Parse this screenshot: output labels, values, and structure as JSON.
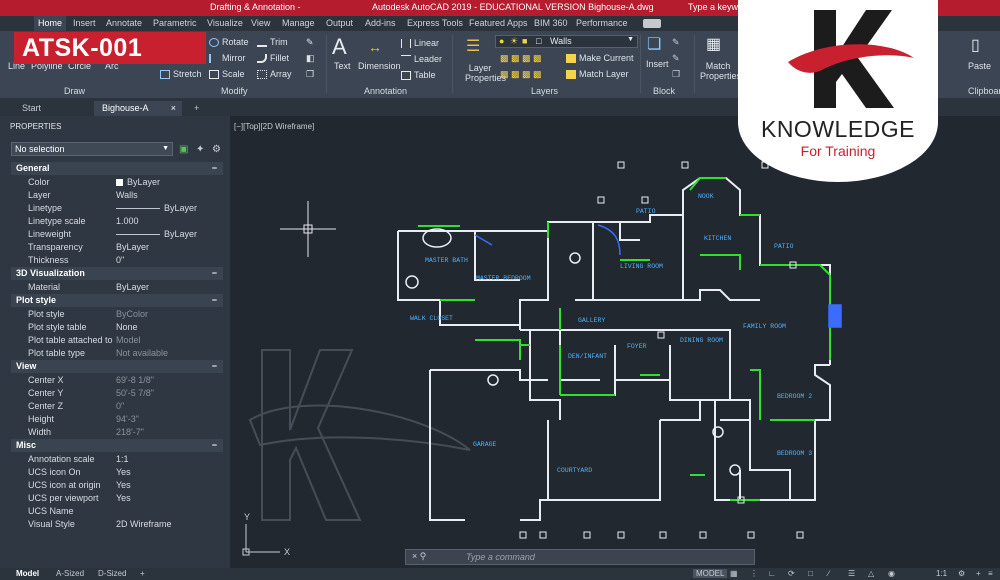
{
  "titlebar": {
    "left": "Drafting & Annotation -",
    "center": "Autodesk AutoCAD 2019 - EDUCATIONAL VERSION   Bighouse-A.dwg",
    "search": "Type a keyword"
  },
  "tabs": [
    "Home",
    "Insert",
    "Annotate",
    "Parametric",
    "Visualize",
    "View",
    "Manage",
    "Output",
    "Add-ins",
    "Express Tools",
    "Featured Apps",
    "BIM 360",
    "Performance"
  ],
  "ribbon": {
    "draw_tools": [
      "Line",
      "Polyline",
      "Circle",
      "Arc"
    ],
    "modify_tools": [
      "Rotate",
      "Mirror",
      "Stretch",
      "Trim",
      "Fillet",
      "Scale",
      "Array"
    ],
    "annotation_tools": [
      "Text",
      "Dimension",
      "Linear",
      "Leader",
      "Table"
    ],
    "layer_properties": "Layer Properties",
    "layer_current": "Walls",
    "layer_tools": [
      "Make Current",
      "Match Layer"
    ],
    "insert": "Insert",
    "match_properties": "Match Properties",
    "paste": "Paste",
    "panels": [
      "Draw",
      "Modify",
      "Annotation",
      "Layers",
      "Block",
      "Clipboard"
    ]
  },
  "banner": "ATSK-001",
  "logo": {
    "title": "KNOWLEDGE",
    "subtitle": "For Training"
  },
  "doctabs": [
    "Start",
    "Bighouse-A"
  ],
  "properties": {
    "title": "PROPERTIES",
    "selection": "No selection",
    "sections": [
      {
        "name": "General",
        "rows": [
          {
            "k": "Color",
            "v": "ByLayer"
          },
          {
            "k": "Layer",
            "v": "Walls"
          },
          {
            "k": "Linetype",
            "v": "ByLayer"
          },
          {
            "k": "Linetype scale",
            "v": "1.000"
          },
          {
            "k": "Lineweight",
            "v": "ByLayer"
          },
          {
            "k": "Transparency",
            "v": "ByLayer"
          },
          {
            "k": "Thickness",
            "v": "0\""
          }
        ]
      },
      {
        "name": "3D Visualization",
        "rows": [
          {
            "k": "Material",
            "v": "ByLayer"
          }
        ]
      },
      {
        "name": "Plot style",
        "rows": [
          {
            "k": "Plot style",
            "v": "ByColor"
          },
          {
            "k": "Plot style table",
            "v": "None"
          },
          {
            "k": "Plot table attached to",
            "v": "Model"
          },
          {
            "k": "Plot table type",
            "v": "Not available"
          }
        ]
      },
      {
        "name": "View",
        "rows": [
          {
            "k": "Center X",
            "v": "69'-8 1/8\""
          },
          {
            "k": "Center Y",
            "v": "50'-5 7/8\""
          },
          {
            "k": "Center Z",
            "v": "0\""
          },
          {
            "k": "Height",
            "v": "94'-3\""
          },
          {
            "k": "Width",
            "v": "218'-7\""
          }
        ]
      },
      {
        "name": "Misc",
        "rows": [
          {
            "k": "Annotation scale",
            "v": "1:1"
          },
          {
            "k": "UCS icon On",
            "v": "Yes"
          },
          {
            "k": "UCS icon at origin",
            "v": "Yes"
          },
          {
            "k": "UCS per viewport",
            "v": "Yes"
          },
          {
            "k": "UCS Name",
            "v": ""
          },
          {
            "k": "Visual Style",
            "v": "2D Wireframe"
          }
        ]
      }
    ]
  },
  "viewport_label": "[−][Top][2D Wireframe]",
  "plan_labels": {
    "patio_top": "PATIO",
    "patio_right": "PATIO",
    "nook": "NOOK",
    "kitchen": "KITCHEN",
    "living_room": "LIVING ROOM",
    "master_bath": "MASTER BATH",
    "master_bedroom": "MASTER BEDROOM",
    "gallery": "GALLERY",
    "den_infant": "DEN/INFANT",
    "foyer": "FOYER",
    "dining_room": "DINING ROOM",
    "family_room": "FAMILY ROOM",
    "bedroom2": "BEDROOM 2",
    "bedroom3": "BEDROOM 3",
    "garage": "GARAGE",
    "courtyard": "COURTYARD",
    "walk_closet": "WALK CLOSET",
    "y_axis": "Y",
    "x_axis": "X"
  },
  "command": {
    "placeholder": "Type a command"
  },
  "status": {
    "tabs": [
      "Model",
      "A-Sized",
      "D-Sized"
    ],
    "mode": "MODEL",
    "scale": "1:1"
  },
  "colors": {
    "accent": "#c8202f",
    "wall": "#e9edf1",
    "green": "#2fe02f",
    "blue": "#3a6cff",
    "cyan": "#46a8ff"
  }
}
